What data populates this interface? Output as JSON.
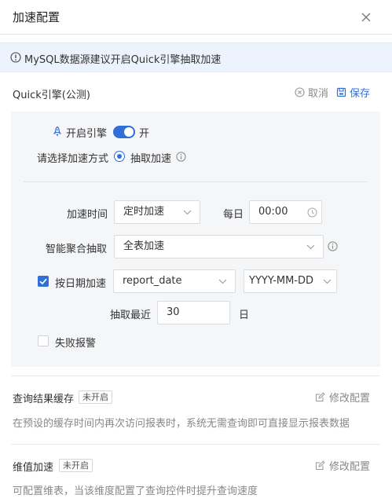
{
  "dialog": {
    "title": "加速配置"
  },
  "notice": {
    "text": "MySQL数据源建议开启Quick引擎抽取加速"
  },
  "quick_engine": {
    "title": "Quick引擎(公测)",
    "cancel_label": "取消",
    "save_label": "保存",
    "enable_label": "开启引擎",
    "toggle_state": "开",
    "method_label": "请选择加速方式",
    "method_option": "抽取加速",
    "accel_time_label": "加速时间",
    "accel_time_value": "定时加速",
    "daily_label": "每日",
    "time_value": "00:00",
    "smart_agg_label": "智能聚合抽取",
    "smart_agg_value": "全表加速",
    "date_accel_label": "按日期加速",
    "date_field_value": "report_date",
    "date_format_value": "YYYY-MM-DD",
    "recent_label": "抽取最近",
    "recent_value": "30",
    "day_unit": "日",
    "fail_alert_label": "失败报警"
  },
  "query_cache": {
    "title": "查询结果缓存",
    "badge": "未开启",
    "edit_label": "修改配置",
    "desc": "在预设的缓存时间内再次访问报表时，系统无需查询即可直接显示报表数据"
  },
  "dim_accel": {
    "title": "维值加速",
    "badge": "未开启",
    "edit_label": "修改配置",
    "desc": "可配置维表，当该维度配置了查询控件时提升查询速度"
  }
}
